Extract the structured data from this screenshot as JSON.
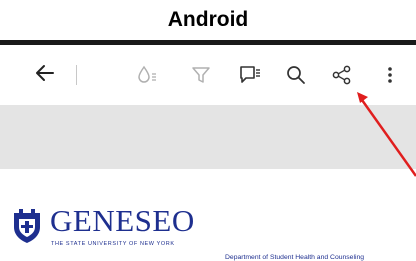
{
  "heading": "Android",
  "toolbar": {
    "icons": [
      "back-arrow-icon",
      "ink-drop-icon",
      "filter-icon",
      "comment-icon",
      "search-icon",
      "share-icon",
      "more-vertical-icon"
    ]
  },
  "document": {
    "logo_name": "GENESEO",
    "logo_subtitle": "THE STATE UNIVERSITY OF NEW YORK",
    "department": "Department of Student Health and Counseling"
  },
  "colors": {
    "brand_blue": "#1e2f8f",
    "annotation_arrow": "#e01e1e",
    "toolbar_icon": "#333333",
    "toolbar_icon_disabled": "#b0b0b0"
  }
}
